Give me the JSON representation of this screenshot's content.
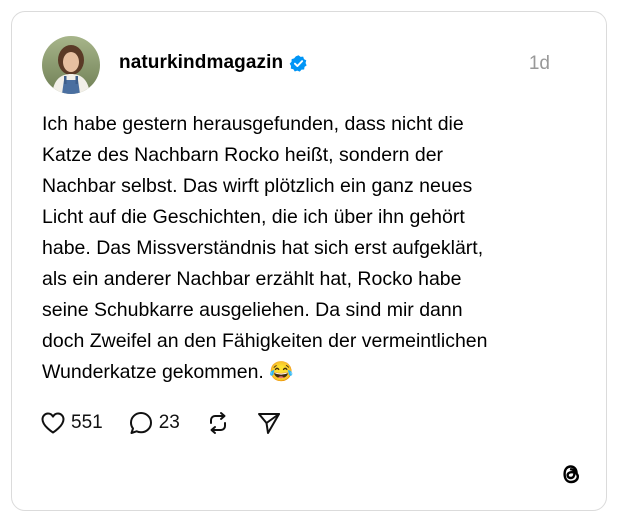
{
  "post": {
    "username": "naturkindmagazin",
    "verified_icon": "verified-badge-icon",
    "timestamp": "1d",
    "text_lines": [
      "Ich habe gestern herausgefunden, dass nicht die",
      "Katze des Nachbarn Rocko heißt, sondern der",
      "Nachbar selbst. Das wirft plötzlich ein ganz neues",
      "Licht auf die Geschichten, die ich über ihn gehört",
      "habe. Das Missverständnis hat sich erst aufgeklärt,",
      "als ein anderer Nachbar erzählt hat, Rocko habe",
      "seine Schubkarre ausgeliehen. Da sind mir dann",
      "doch Zweifel an den Fähigkeiten der vermeintlichen",
      "Wunderkatze gekommen. 😂"
    ]
  },
  "actions": {
    "like_count": "551",
    "reply_count": "23",
    "like_icon": "heart-icon",
    "reply_icon": "comment-icon",
    "repost_icon": "repost-icon",
    "share_icon": "send-icon"
  },
  "branding": {
    "logo": "threads-logo-icon"
  },
  "colors": {
    "verified_blue": "#0095f6",
    "timestamp_gray": "#999999",
    "card_border": "#dbdbdb"
  }
}
